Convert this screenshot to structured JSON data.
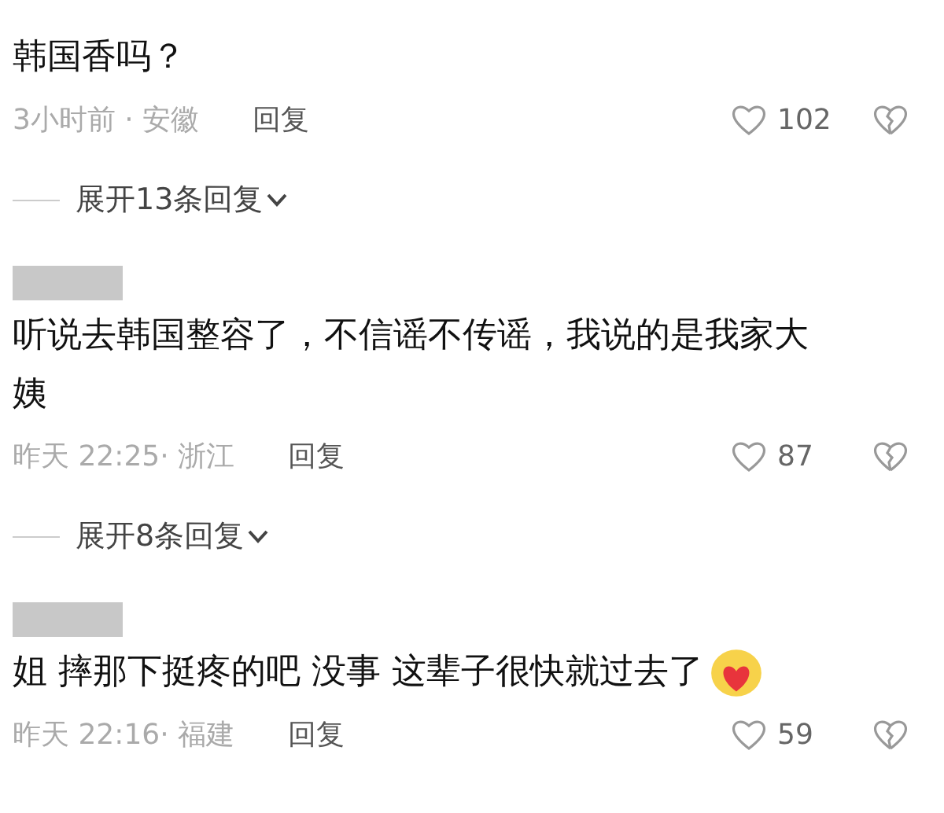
{
  "items": [
    {
      "kind": "comment",
      "name_redacted": false,
      "text": "韩国香吗？",
      "emoji": false,
      "meta": "3小时前 · 安徽",
      "reply": "回复",
      "likes": "102"
    },
    {
      "kind": "expand",
      "label": "展开13条回复"
    },
    {
      "kind": "comment",
      "name_redacted": true,
      "text": "听说去韩国整容了，不信谣不传谣，我说的是我家大姨",
      "emoji": false,
      "meta": "昨天 22:25· 浙江",
      "reply": "回复",
      "likes": "87"
    },
    {
      "kind": "expand",
      "label": "展开8条回复"
    },
    {
      "kind": "comment",
      "name_redacted": true,
      "text": "姐 摔那下挺疼的吧 没事 这辈子很快就过去了",
      "emoji": true,
      "meta": "昨天 22:16· 福建",
      "reply": "回复",
      "likes": "59"
    }
  ]
}
